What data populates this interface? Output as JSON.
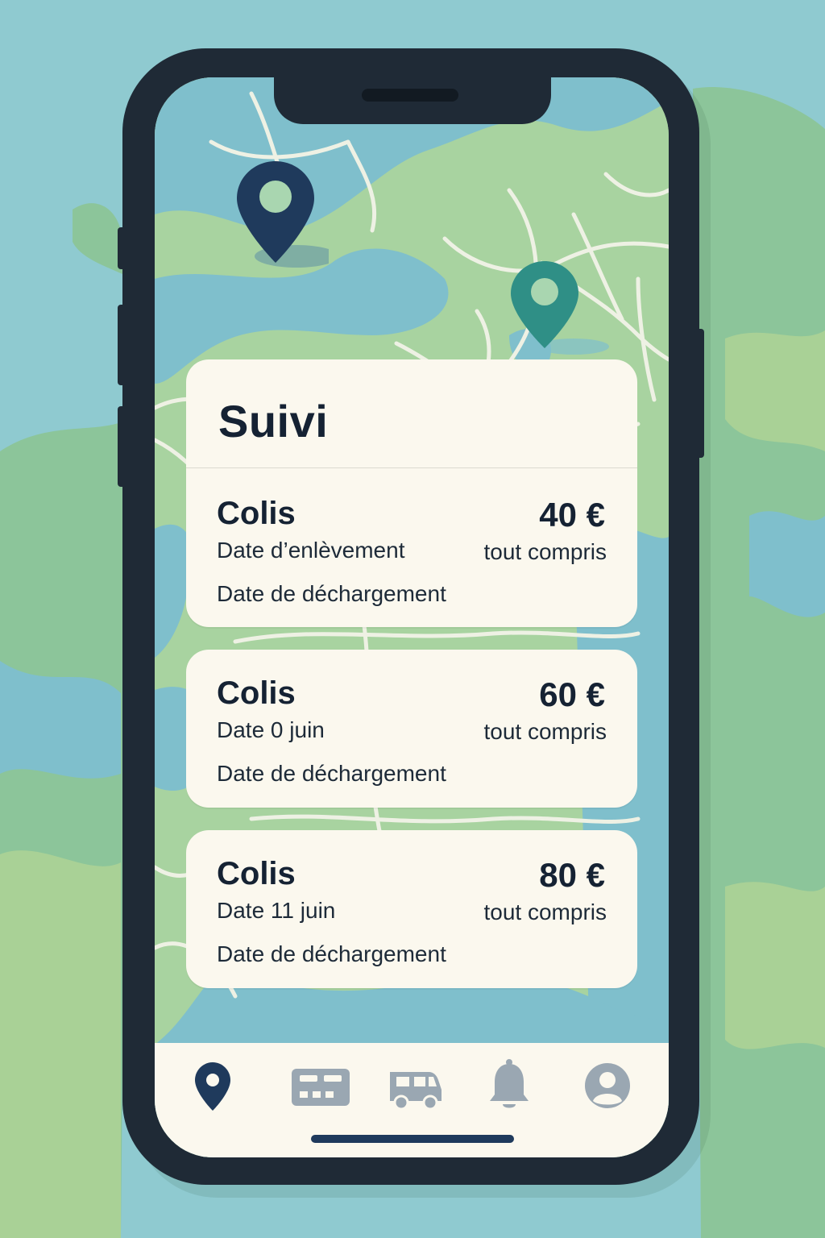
{
  "colors": {
    "navy": "#1f3a5c",
    "teal": "#2f8f86",
    "card": "#fbf8ee",
    "text": "#152233",
    "inactive_icon": "#9aa7b2",
    "land": "#a8d3a0",
    "water": "#7fbfcc"
  },
  "map": {
    "pins": [
      {
        "name": "pickup",
        "icon": "map-pin-icon",
        "color": "#1f3a5c"
      },
      {
        "name": "delivery",
        "icon": "map-pin-icon",
        "color": "#2f8f86"
      }
    ]
  },
  "header": {
    "title": "Suivi"
  },
  "shipments": [
    {
      "title": "Colis",
      "date": "Date d’enlèvement",
      "unload": "Date de déchargement",
      "price": "40 €",
      "price_note": "tout compris"
    },
    {
      "title": "Colis",
      "date": "Date 0 juin",
      "unload": "Date de déchargement",
      "price": "60 €",
      "price_note": "tout compris"
    },
    {
      "title": "Colis",
      "date": "Date 11 juin",
      "unload": "Date de déchargement",
      "price": "80 €",
      "price_note": "tout compris"
    }
  ],
  "tabbar": {
    "active": "map",
    "tabs": [
      {
        "id": "map",
        "icon": "location-pin-icon"
      },
      {
        "id": "ticket",
        "icon": "ticket-icon"
      },
      {
        "id": "truck",
        "icon": "truck-icon"
      },
      {
        "id": "notifications",
        "icon": "bell-icon"
      },
      {
        "id": "profile",
        "icon": "user-avatar-icon"
      }
    ]
  }
}
